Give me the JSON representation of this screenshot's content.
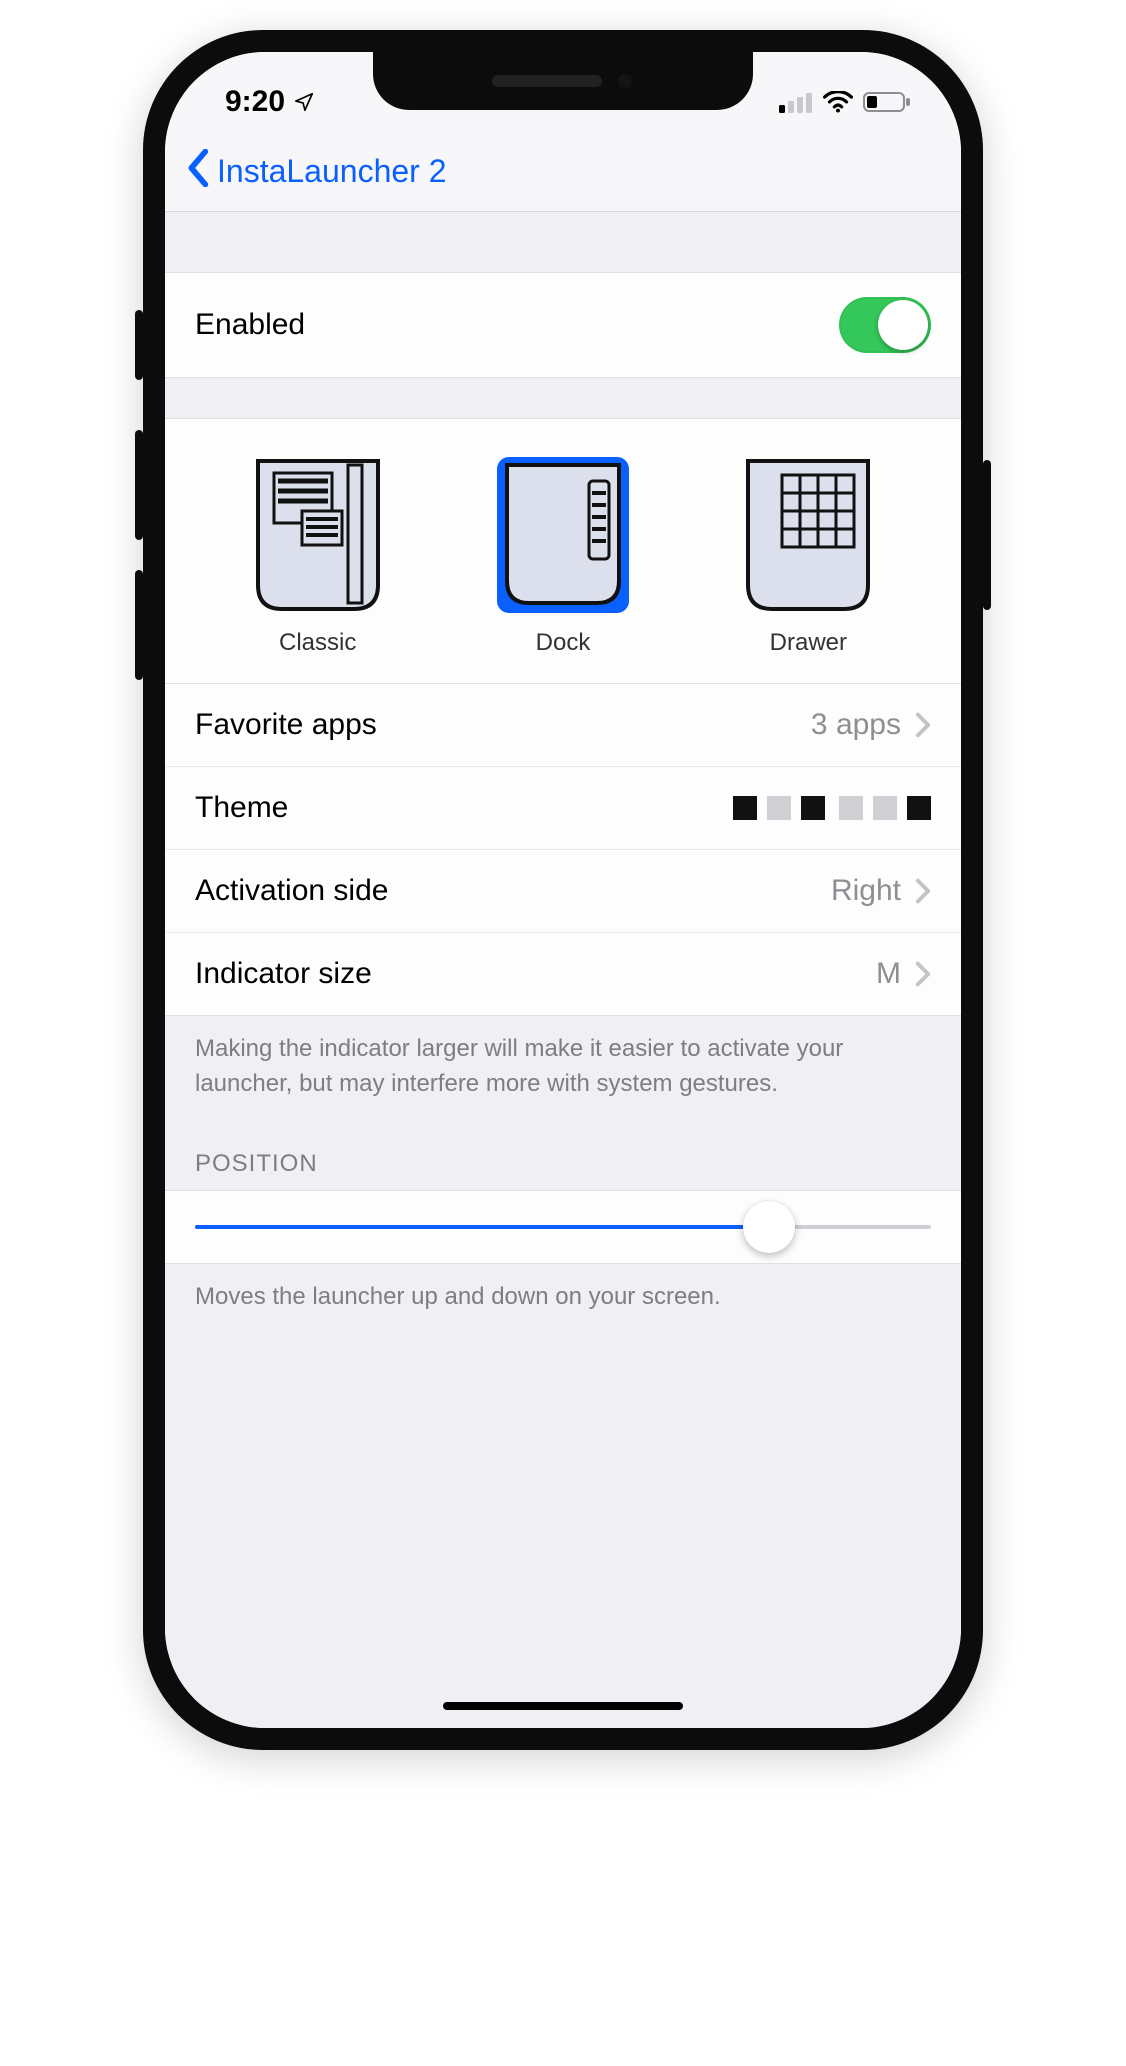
{
  "status": {
    "time": "9:20"
  },
  "nav": {
    "back_label": "InstaLauncher 2"
  },
  "enabled": {
    "label": "Enabled",
    "on": true
  },
  "styles": {
    "items": [
      {
        "label": "Classic"
      },
      {
        "label": "Dock"
      },
      {
        "label": "Drawer"
      }
    ],
    "selected": "Dock"
  },
  "rows": {
    "favorite": {
      "label": "Favorite apps",
      "value": "3 apps"
    },
    "theme": {
      "label": "Theme"
    },
    "activation_side": {
      "label": "Activation side",
      "value": "Right"
    },
    "indicator_size": {
      "label": "Indicator size",
      "value": "M"
    }
  },
  "indicator_footer": "Making the indicator larger will make it easier to activate your launcher, but may interfere more with system gestures.",
  "position": {
    "header": "POSITION",
    "value_percent": 78,
    "footer": "Moves the launcher up and down on your screen."
  }
}
